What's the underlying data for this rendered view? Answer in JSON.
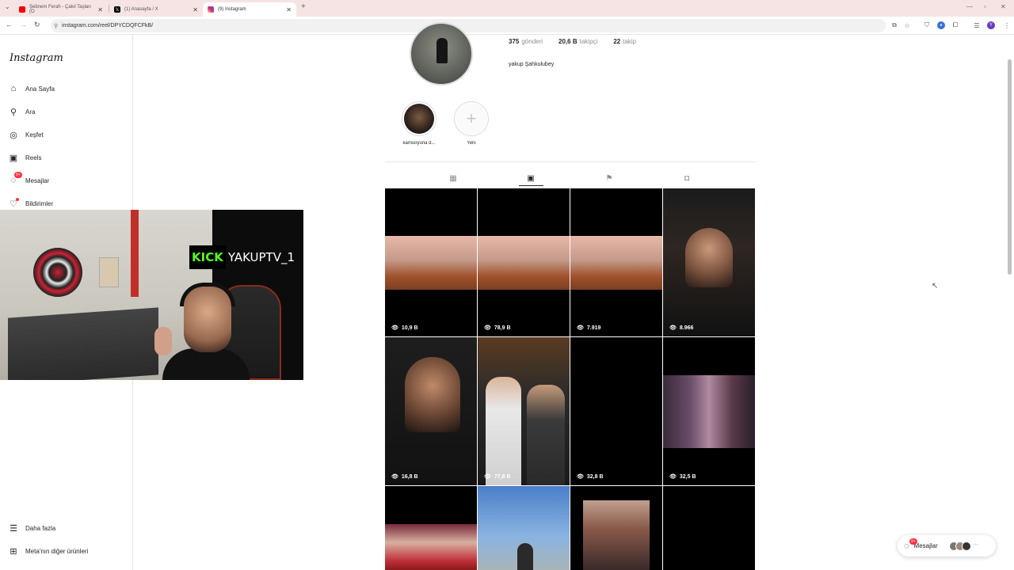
{
  "browser": {
    "tabs": [
      {
        "title": "Şebnem Ferah - Çakıl Taşları (O",
        "favicon_color": "#ff0000",
        "active": false
      },
      {
        "title": "(1) Anasayfa / X",
        "favicon_color": "#000000",
        "active": false
      },
      {
        "title": "(9) Instagram",
        "favicon_color": "#d62976",
        "active": true
      }
    ],
    "url": "instagram.com/reel/DPYCDQFCFkB/",
    "new_tab_label": "+",
    "profile_initial": "Y"
  },
  "sidebar": {
    "logo": "Instagram",
    "items": [
      {
        "label": "Ana Sayfa",
        "icon": "home-icon"
      },
      {
        "label": "Ara",
        "icon": "search-icon"
      },
      {
        "label": "Keşfet",
        "icon": "compass-icon"
      },
      {
        "label": "Reels",
        "icon": "reels-icon"
      },
      {
        "label": "Mesajlar",
        "icon": "messenger-icon",
        "badge": "9+"
      },
      {
        "label": "Bildirimler",
        "icon": "heart-icon"
      }
    ],
    "bottom_items": [
      {
        "label": "Daha fazla",
        "icon": "menu-icon"
      },
      {
        "label": "Meta'nın diğer ürünleri",
        "icon": "meta-icon"
      }
    ]
  },
  "profile": {
    "posts_count": "375",
    "posts_label": "gönderi",
    "followers_count": "20,6 B",
    "followers_label": "takipçi",
    "following_count": "22",
    "following_label": "takip",
    "full_name": "yakup Şahkulubey",
    "highlights": [
      {
        "label": "kamuoyuna d..."
      },
      {
        "label": "Yeni"
      }
    ]
  },
  "profile_tabs": [
    {
      "icon": "grid-icon"
    },
    {
      "icon": "reels-tab-icon",
      "active": true
    },
    {
      "icon": "saved-icon"
    },
    {
      "icon": "tagged-icon"
    }
  ],
  "reels": [
    {
      "views": "10,9 B"
    },
    {
      "views": "78,9 B"
    },
    {
      "views": "7.919"
    },
    {
      "views": "8.966"
    },
    {
      "views": "16,8 B"
    },
    {
      "views": "77,8 B"
    },
    {
      "views": "32,8 B"
    },
    {
      "views": "32,5 B"
    },
    {
      "views": ""
    },
    {
      "views": ""
    },
    {
      "views": ""
    },
    {
      "views": ""
    }
  ],
  "overlay": {
    "brand": "KICK",
    "channel": "YAKUPTV_1"
  },
  "messages_pill": {
    "label": "Mesajlar",
    "badge": "9+"
  },
  "colors": {
    "tabbar_bg": "#f6e4e4",
    "kick_green": "#53fc18",
    "notification_red": "#ff3040"
  }
}
